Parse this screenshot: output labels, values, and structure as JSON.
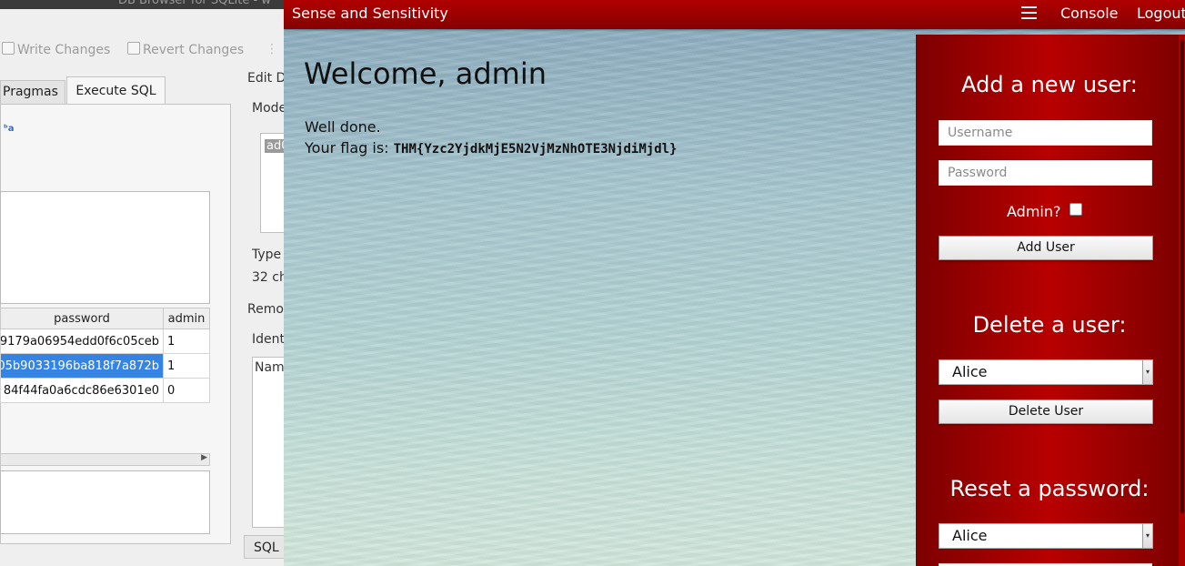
{
  "db_browser": {
    "title": "DB Browser for SQLite - w",
    "toolbar": {
      "write_changes": "Write Changes",
      "revert_changes": "Revert Changes"
    },
    "tabs": [
      "Pragmas",
      "Execute SQL"
    ],
    "side_labels": {
      "edit": "Edit D",
      "mode": "Mode",
      "mode_value": "ad0",
      "type": "Type",
      "chars": "32 ch",
      "remote": "Remo",
      "identity": "Ident",
      "name_col": "Nam",
      "sql_tab": "SQL"
    },
    "table": {
      "columns": [
        "password",
        "admin"
      ],
      "rows": [
        {
          "password": "9179a06954edd0f6c05ceb",
          "admin": "1",
          "selected": false
        },
        {
          "password": "05b9033196ba818f7a872b",
          "admin": "1",
          "selected": true
        },
        {
          "password": "84f44fa0a6cdc86e6301e0",
          "admin": "0",
          "selected": false
        }
      ]
    }
  },
  "web": {
    "navbar": {
      "brand": "Sense and Sensitivity",
      "console": "Console",
      "logout": "Logout"
    },
    "main": {
      "welcome": "Welcome, admin",
      "well_done": "Well done.",
      "flag_prefix": "Your flag is: ",
      "flag_value": "THM{Yzc2YjdkMjE5N2VjMzNhOTE3NjdiMjdl}"
    },
    "sidebar": {
      "add_user": {
        "heading": "Add a new user:",
        "username_placeholder": "Username",
        "password_placeholder": "Password",
        "admin_label": "Admin?",
        "admin_checked": false,
        "button": "Add User"
      },
      "delete_user": {
        "heading": "Delete a user:",
        "selected": "Alice",
        "button": "Delete User"
      },
      "reset_password": {
        "heading": "Reset a password:",
        "selected": "Alice"
      }
    }
  },
  "colors": {
    "navbar": "#a30000",
    "sidebar": "#9c0000",
    "selection": "#3584e4"
  }
}
